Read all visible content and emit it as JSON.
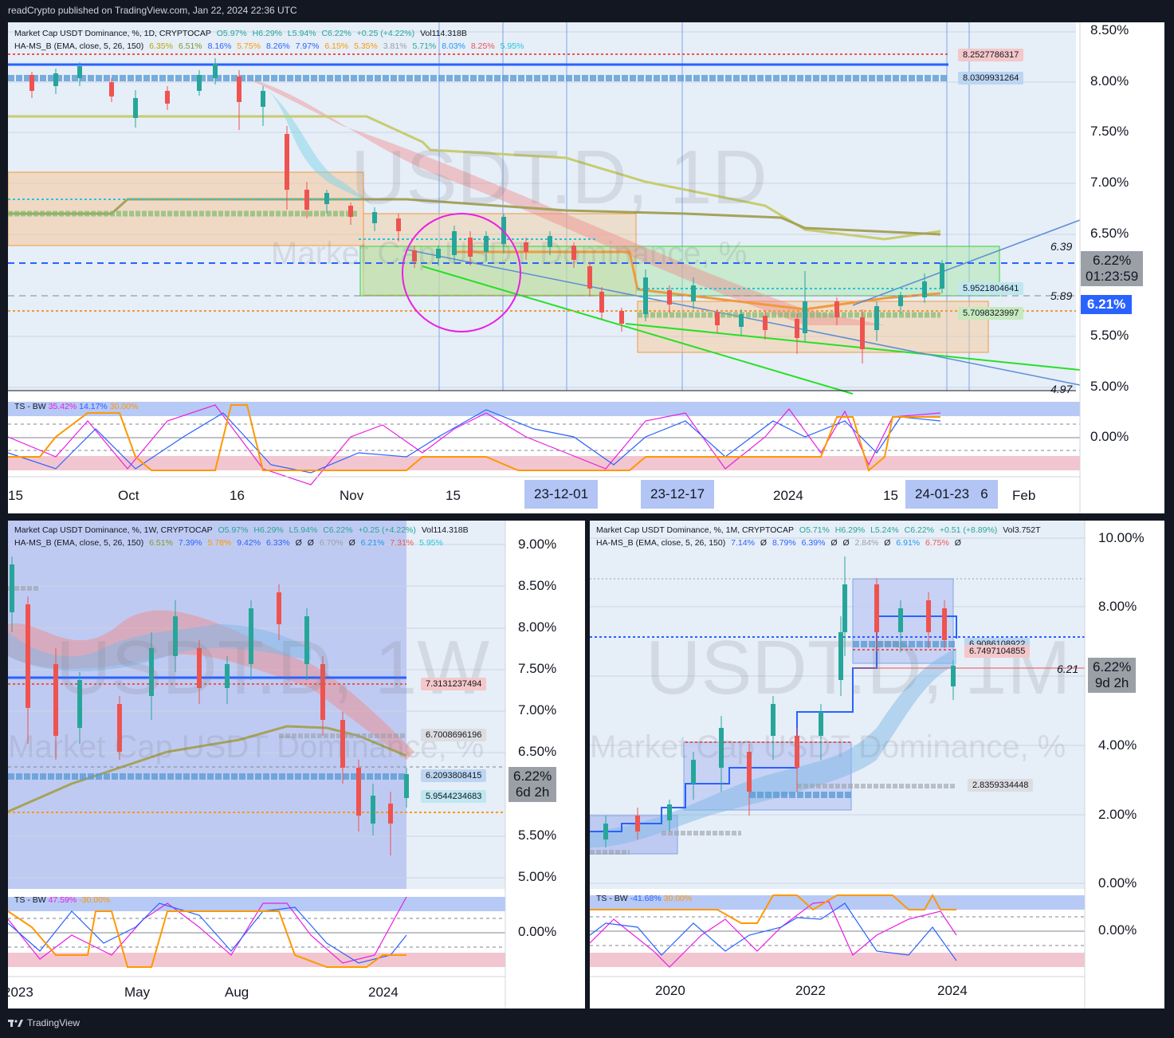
{
  "header": {
    "text": "readCrypto published on TradingView.com, Jan 22, 2024 22:36 UTC"
  },
  "footer": {
    "brand": "TradingView"
  },
  "colors": {
    "bg": "#131722",
    "up": "#26a69a",
    "down": "#ef5350",
    "accent": "#2962ff",
    "magenta": "#e91ee3",
    "green": "#00e600",
    "orange": "#ff9800",
    "olive": "#a4a635"
  },
  "daily": {
    "legend1": {
      "symbol": "Market Cap USDT Dominance, %, 1D, CRYPTOCAP",
      "o": "O5.97%",
      "h": "H6.29%",
      "l": "L5.94%",
      "c": "C6.22%",
      "chg": "+0.25 (+4.22%)",
      "vol": "Vol114.318B"
    },
    "legend2": {
      "name": "HA-MS_B (EMA, close, 5, 26, 150)",
      "v": [
        "6.35%",
        "6.51%",
        "8.16%",
        "5.75%",
        "8.26%",
        "7.97%",
        "6.15%",
        "5.35%",
        "3.81%",
        "5.71%",
        "8.03%",
        "8.25%",
        "5.95%"
      ]
    },
    "watermark1": "USDT.D, 1D",
    "watermark2": "Market Cap USDT Dominance, %",
    "y_labels": [
      "8.50%",
      "8.00%",
      "7.50%",
      "7.00%",
      "6.50%",
      "6.22%",
      "5.50%",
      "5.00%",
      "0.00%"
    ],
    "x_labels": [
      "15",
      "Oct",
      "16",
      "Nov",
      "15",
      "2024",
      "15",
      "6",
      "Feb"
    ],
    "date_tags": [
      "23-12-01",
      "23-12-17",
      "24-01-23"
    ],
    "price": {
      "value": "6.22%",
      "countdown": "01:23:59"
    },
    "blue_price": "6.21%",
    "levels": {
      "l1": "6.39",
      "l2": "5.89",
      "l3": "4.97"
    },
    "tags": {
      "t1": "8.2527786317",
      "t2": "8.0309931264",
      "t3": "5.9521804641",
      "t4": "5.7098323997"
    },
    "osc": {
      "name": "TS - BW",
      "v1": "35.42%",
      "v2": "14.17%",
      "v3": "30.00%"
    }
  },
  "weekly": {
    "legend1": {
      "symbol": "Market Cap USDT Dominance, %, 1W, CRYPTOCAP",
      "o": "O5.97%",
      "h": "H6.29%",
      "l": "L5.94%",
      "c": "C6.22%",
      "chg": "+0.25 (+4.22%)",
      "vol": "Vol114.318B"
    },
    "legend2": {
      "name": "HA-MS_B (EMA, close, 5, 26, 150)",
      "v": [
        "6.51%",
        "7.39%",
        "5.78%",
        "9.42%",
        "6.33%",
        "Ø",
        "Ø",
        "6.70%",
        "Ø",
        "6.21%",
        "7.31%",
        "5.95%"
      ]
    },
    "watermark1": "USDT.D, 1W",
    "watermark2": "Market Cap USDT Dominance, %",
    "y_labels": [
      "9.00%",
      "8.50%",
      "8.00%",
      "7.50%",
      "7.00%",
      "6.50%",
      "5.50%",
      "5.00%",
      "0.00%"
    ],
    "x_labels": [
      "2023",
      "May",
      "Aug",
      "2024"
    ],
    "price": {
      "value": "6.22%",
      "countdown": "6d 2h"
    },
    "tags": {
      "t1": "7.3131237494",
      "t2": "6.7008696196",
      "t3": "6.2093808415",
      "t4": "5.9544234683"
    },
    "osc": {
      "name": "TS - BW",
      "v1": "47.59%",
      "v2": "-30.00%"
    }
  },
  "monthly": {
    "legend1": {
      "symbol": "Market Cap USDT Dominance, %, 1M, CRYPTOCAP",
      "o": "O5.71%",
      "h": "H6.29%",
      "l": "L5.24%",
      "c": "C6.22%",
      "chg": "+0.51 (+8.89%)",
      "vol": "Vol3.752T"
    },
    "legend2": {
      "name": "HA-MS_B (EMA, close, 5, 26, 150)",
      "v": [
        "7.14%",
        "Ø",
        "8.79%",
        "6.39%",
        "Ø",
        "Ø",
        "2.84%",
        "Ø",
        "6.91%",
        "6.75%",
        "Ø"
      ]
    },
    "watermark1": "USDT.D, 1M",
    "watermark2": "Market Cap USDT Dominance, %",
    "y_labels": [
      "10.00%",
      "8.00%",
      "4.00%",
      "2.00%",
      "0.00%",
      "0.00%"
    ],
    "x_labels": [
      "2020",
      "2022",
      "2024"
    ],
    "price": {
      "value": "6.22%",
      "countdown": "9d 2h"
    },
    "level": "6.21",
    "tags": {
      "t1": "6.9086108922",
      "t2": "6.7497104855",
      "t3": "2.8359334448"
    },
    "osc": {
      "name": "TS - BW",
      "v1": "-41.68%",
      "v2": "30.00%"
    }
  }
}
